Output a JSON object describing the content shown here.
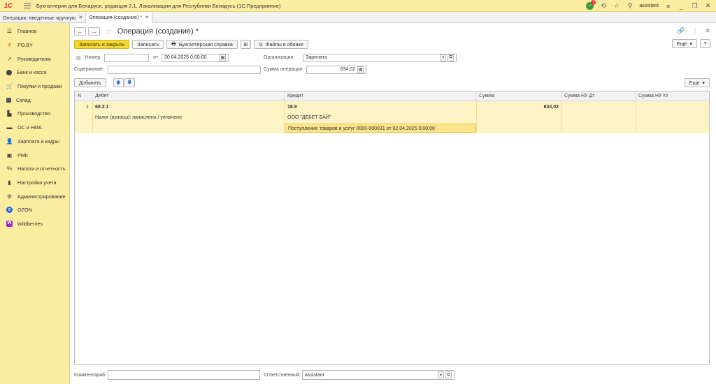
{
  "titlebar": {
    "logo": "1С",
    "title": "Бухгалтерия для Беларуси, редакция 2.1. Локализация для Республики Беларусь   (1С:Предприятие)",
    "notif_count": "1",
    "user": "assistant"
  },
  "tabs": [
    {
      "label": "Операции, введенные вручную"
    },
    {
      "label": "Операция (создание) *"
    }
  ],
  "sidebar": {
    "items": [
      {
        "label": "Главное"
      },
      {
        "label": "РО.BY"
      },
      {
        "label": "Руководителю"
      },
      {
        "label": "Банк и касса"
      },
      {
        "label": "Покупки и продажи"
      },
      {
        "label": "Склад"
      },
      {
        "label": "Производство"
      },
      {
        "label": "ОС и НМА"
      },
      {
        "label": "Зарплата и кадры"
      },
      {
        "label": "РМК"
      },
      {
        "label": "Налоги и отчетность"
      },
      {
        "label": "Настройки учета"
      },
      {
        "label": "Администрирование"
      },
      {
        "label": "OZON"
      },
      {
        "label": "Wildberries"
      }
    ]
  },
  "form": {
    "title": "Операция (создание) *",
    "toolbar": {
      "save_close": "Записать и закрыть",
      "save": "Записать",
      "account_ref": "Бухгалтерская справка",
      "cloud_files": "Файлы в облаке",
      "more": "Еще",
      "help": "?"
    },
    "number_label": "Номер:",
    "number_value": "",
    "date_label": "от:",
    "date_value": "30.04.2025  0:00:00",
    "org_label": "Организация:",
    "org_value": "Зарплата",
    "content_label": "Содержание:",
    "content_value": "",
    "sum_label": "Сумма операции:",
    "sum_value": "634,02",
    "add_button": "Добавить",
    "table_more": "Еще",
    "columns": {
      "n": "N",
      "debit": "Дебет",
      "credit": "Кредит",
      "sum": "Сумма",
      "sum_nu_dt": "Сумма НУ Дт",
      "sum_nu_kt": "Сумма НУ Кт"
    },
    "row": {
      "n": "1",
      "debit_account": "68.2.1",
      "debit_sub1": "Налог (взносы): начислено / уплачено",
      "credit_account": "18.9",
      "credit_sub1": "ООО \"ДЕБЕТ БАЙ\"",
      "credit_sub2": "Поступление товаров и услуг 0000-000031 от 02.04.2025 0:00:00",
      "sum": "634,02"
    },
    "comment_label": "Комментарий:",
    "comment_value": "",
    "responsible_label": "Ответственный:",
    "responsible_value": "assistant"
  }
}
